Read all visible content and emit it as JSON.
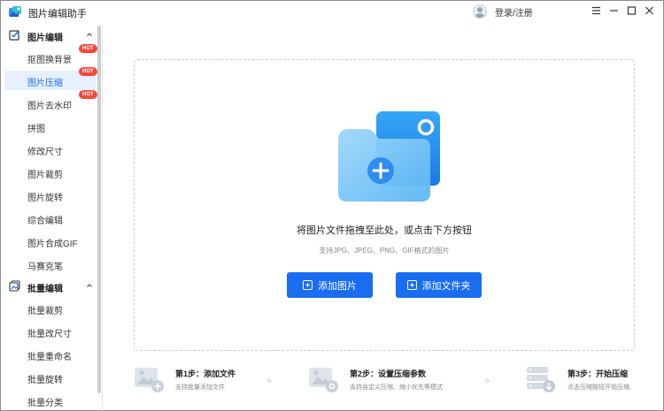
{
  "app": {
    "title": "图片编辑助手",
    "login_label": "登录/注册"
  },
  "window_controls": [
    "menu-icon",
    "minimize-icon",
    "maximize-icon",
    "close-icon"
  ],
  "sidebar": {
    "groups": [
      {
        "label": "图片编辑",
        "icon": "edit-checkbox-icon",
        "expanded": true,
        "items": [
          {
            "label": "抠图换背景",
            "hot": "HOT"
          },
          {
            "label": "图片压缩",
            "hot": "HOT",
            "active": true
          },
          {
            "label": "图片去水印",
            "hot": "HOT"
          },
          {
            "label": "拼图"
          },
          {
            "label": "修改尺寸"
          },
          {
            "label": "图片裁剪"
          },
          {
            "label": "图片旋转"
          },
          {
            "label": "综合编辑"
          },
          {
            "label": "图片合成GIF"
          },
          {
            "label": "马赛克笔"
          }
        ]
      },
      {
        "label": "批量编辑",
        "icon": "batch-edit-icon",
        "expanded": true,
        "items": [
          {
            "label": "批量裁剪"
          },
          {
            "label": "批量改尺寸"
          },
          {
            "label": "批量重命名"
          },
          {
            "label": "批量旋转"
          },
          {
            "label": "批量分类"
          }
        ]
      }
    ]
  },
  "main": {
    "drop_title": "将图片文件拖拽至此处，或点击下方按钮",
    "drop_hint": "支持JPG、JPEG、PNG、GIF格式的图片",
    "add_image_button": "添加图片",
    "add_folder_button": "添加文件夹"
  },
  "steps": [
    {
      "title": "第1步：添加文件",
      "desc": "支持批量添加文件",
      "icon": "add-image-icon"
    },
    {
      "title": "第2步：设置压缩参数",
      "desc": "支持自定义压缩、缩小优先等模式",
      "icon": "image-settings-icon"
    },
    {
      "title": "第3步：开始压缩",
      "desc": "点击压缩按钮开始压缩",
      "icon": "server-download-icon"
    }
  ],
  "colors": {
    "accent": "#1a6df0",
    "hot_badge": "#f04a3c",
    "active_bg": "#e7f0fe"
  }
}
